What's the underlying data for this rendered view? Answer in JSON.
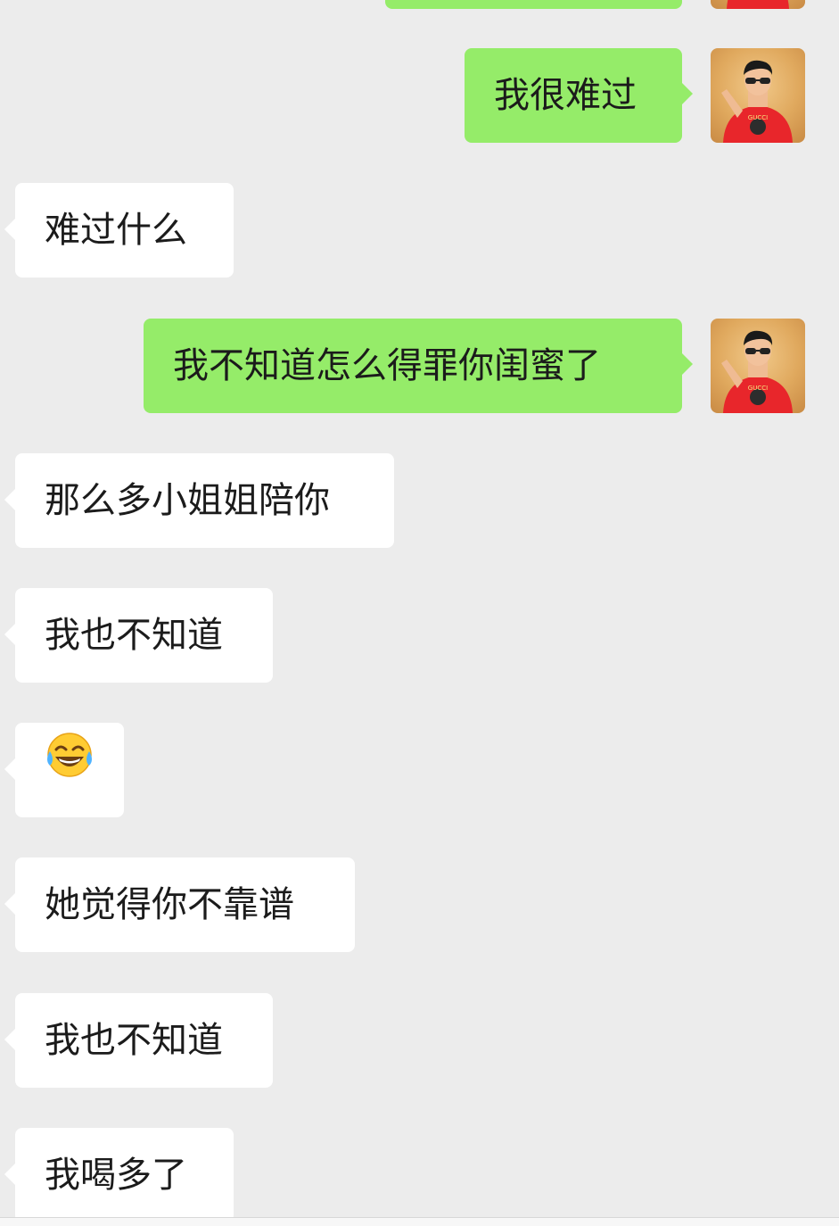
{
  "chat": {
    "messages": [
      {
        "side": "out",
        "text": "我很难过"
      },
      {
        "side": "in",
        "text": "难过什么"
      },
      {
        "side": "out",
        "text": "我不知道怎么得罪你闺蜜了"
      },
      {
        "side": "in",
        "text": "那么多小姐姐陪你"
      },
      {
        "side": "in",
        "text": "我也不知道"
      },
      {
        "side": "in",
        "emoji": "tears-of-joy-emoji"
      },
      {
        "side": "in",
        "text": "她觉得你不靠谱"
      },
      {
        "side": "in",
        "text": "我也不知道"
      },
      {
        "side": "in",
        "text": "我喝多了"
      }
    ],
    "avatar": {
      "shirt_text": "GUCCI",
      "icon": "avatar-man-red-shirt"
    }
  },
  "colors": {
    "background": "#ececec",
    "outgoing_bubble": "#95ec69",
    "incoming_bubble": "#ffffff"
  }
}
